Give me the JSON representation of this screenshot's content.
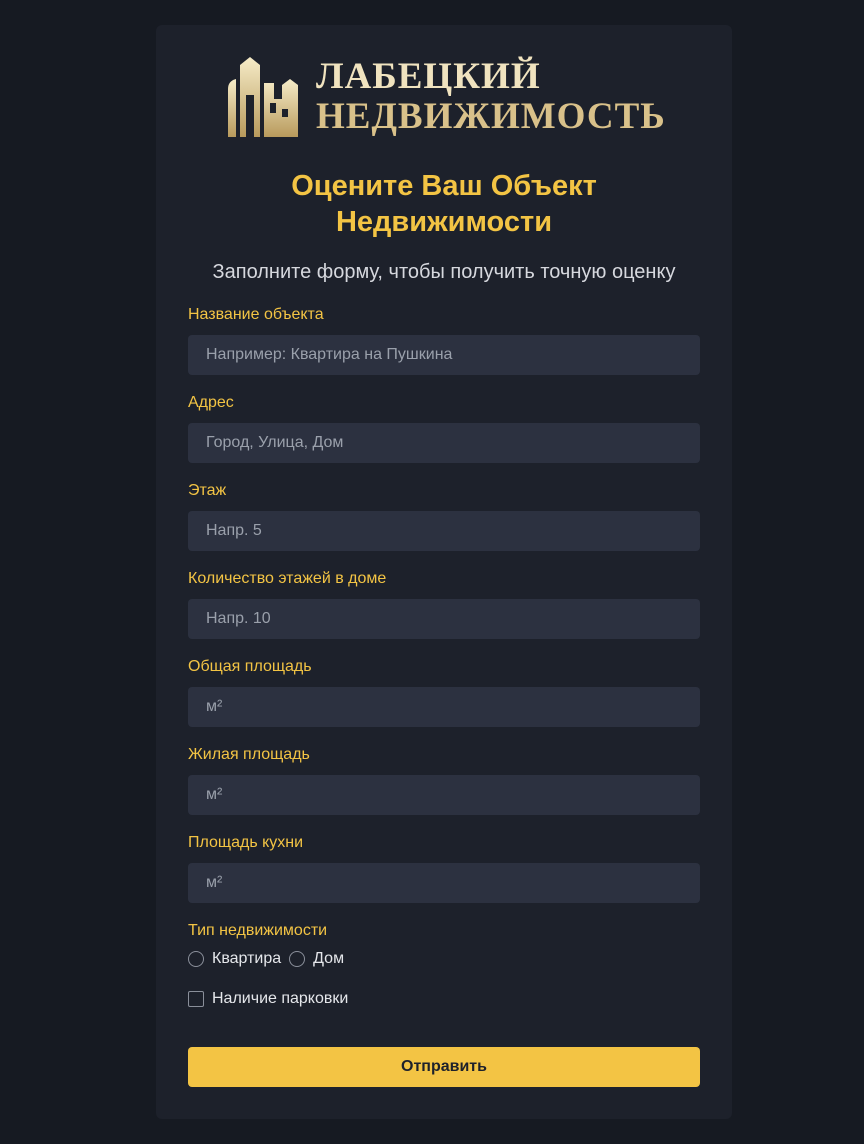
{
  "brand": {
    "line1": "ЛАБЕЦКИЙ",
    "line2": "НЕДВИЖИМОСТЬ"
  },
  "header": {
    "title": "Оцените Ваш Объект Недвижимости",
    "subtitle": "Заполните форму, чтобы получить точную оценку"
  },
  "form": {
    "fields": [
      {
        "label": "Название объекта",
        "value": "",
        "placeholder": "Например: Квартира на Пушкина"
      },
      {
        "label": "Адрес",
        "value": "",
        "placeholder": "Город, Улица, Дом"
      },
      {
        "label": "Этаж",
        "value": "",
        "placeholder": "Напр. 5"
      },
      {
        "label": "Количество этажей в доме",
        "value": "",
        "placeholder": "Напр. 10"
      },
      {
        "label": "Общая площадь",
        "value": "",
        "placeholder": "м²"
      },
      {
        "label": "Жилая площадь",
        "value": "",
        "placeholder": "м²"
      },
      {
        "label": "Площадь кухни",
        "value": "",
        "placeholder": "м²"
      }
    ],
    "property_type": {
      "label": "Тип недвижимости",
      "options": [
        "Квартира",
        "Дом"
      ]
    },
    "parking_label": "Наличие парковки",
    "submit_label": "Отправить"
  },
  "colors": {
    "background": "#161a22",
    "card": "#1d212b",
    "accent": "#f3c444",
    "input_bg": "#2c3140",
    "logo_gold": "#d9c18a"
  },
  "icons": {
    "logo": "building-logo-icon"
  }
}
